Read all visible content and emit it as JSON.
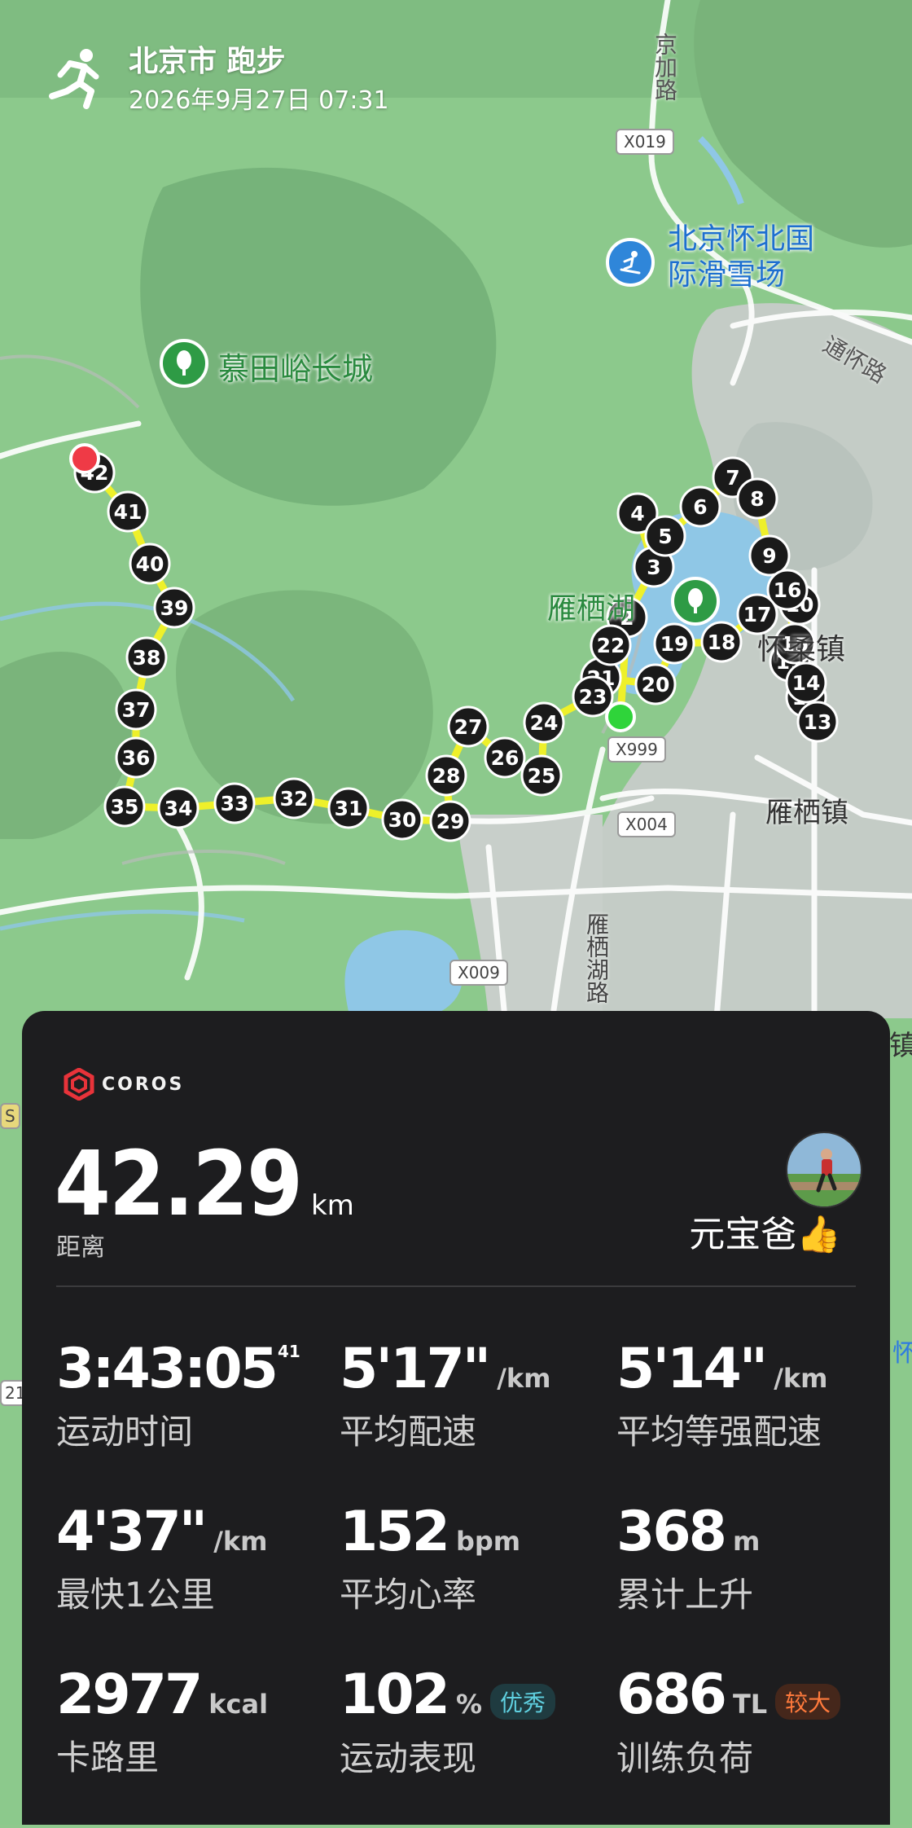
{
  "header": {
    "title": "北京市 跑步",
    "datetime": "2026年9月27日 07:31",
    "activity_icon": "running-person-icon"
  },
  "map": {
    "poi_labels": {
      "ski": "北京怀北国\n际滑雪场",
      "ski_line1": "北京怀北国",
      "ski_line2": "际滑雪场",
      "greatwall": "慕田峪长城",
      "lake": "雁栖湖"
    },
    "place_labels": {
      "town1": "雁栖镇",
      "town_partial": "怀柔镇",
      "edge_town": "镇",
      "road_jingjia": "京加路",
      "road_tonghuai": "通怀路",
      "road_yanqi": "雁栖湖路"
    },
    "road_badges": [
      "X019",
      "X999",
      "X004",
      "X009"
    ],
    "edge_marks": [
      "S",
      "21",
      "怀"
    ],
    "split_markers": [
      "2",
      "3",
      "4",
      "5",
      "6",
      "7",
      "8",
      "9",
      "10",
      "11",
      "12",
      "13",
      "14",
      "15",
      "16",
      "17",
      "18",
      "19",
      "20",
      "21",
      "22",
      "23",
      "24",
      "25",
      "26",
      "27",
      "28",
      "29",
      "30",
      "31",
      "32",
      "33",
      "34",
      "35",
      "36",
      "37",
      "38",
      "39",
      "40",
      "41",
      "42"
    ],
    "colors": {
      "route": "#eef02a",
      "start": "#2fd43a",
      "end": "#ef3a46",
      "marker": "#1a1a1a"
    }
  },
  "card": {
    "brand": "COROS",
    "brand_color": "#e8333a",
    "distance": {
      "value": "42.29",
      "unit": "km",
      "label": "距离"
    },
    "user": {
      "name": "元宝爸👍"
    },
    "stats": [
      {
        "value": "3:43:05",
        "sup": "41",
        "unit": "",
        "label": "运动时间"
      },
      {
        "value": "5'17\"",
        "unit": "/km",
        "label": "平均配速"
      },
      {
        "value": "5'14\"",
        "unit": "/km",
        "label": "平均等强配速"
      },
      {
        "value": "4'37\"",
        "unit": "/km",
        "label": "最快1公里"
      },
      {
        "value": "152",
        "unit": "bpm",
        "label": "平均心率"
      },
      {
        "value": "368",
        "unit": "m",
        "label": "累计上升"
      },
      {
        "value": "2977",
        "unit": "kcal",
        "label": "卡路里"
      },
      {
        "value": "102",
        "unit": "%",
        "badge": "优秀",
        "badge_color": "#5fd0e0",
        "label": "运动表现"
      },
      {
        "value": "686",
        "unit": "TL",
        "badge": "较大",
        "badge_color": "#ff7a3c",
        "label": "训练负荷"
      }
    ]
  }
}
